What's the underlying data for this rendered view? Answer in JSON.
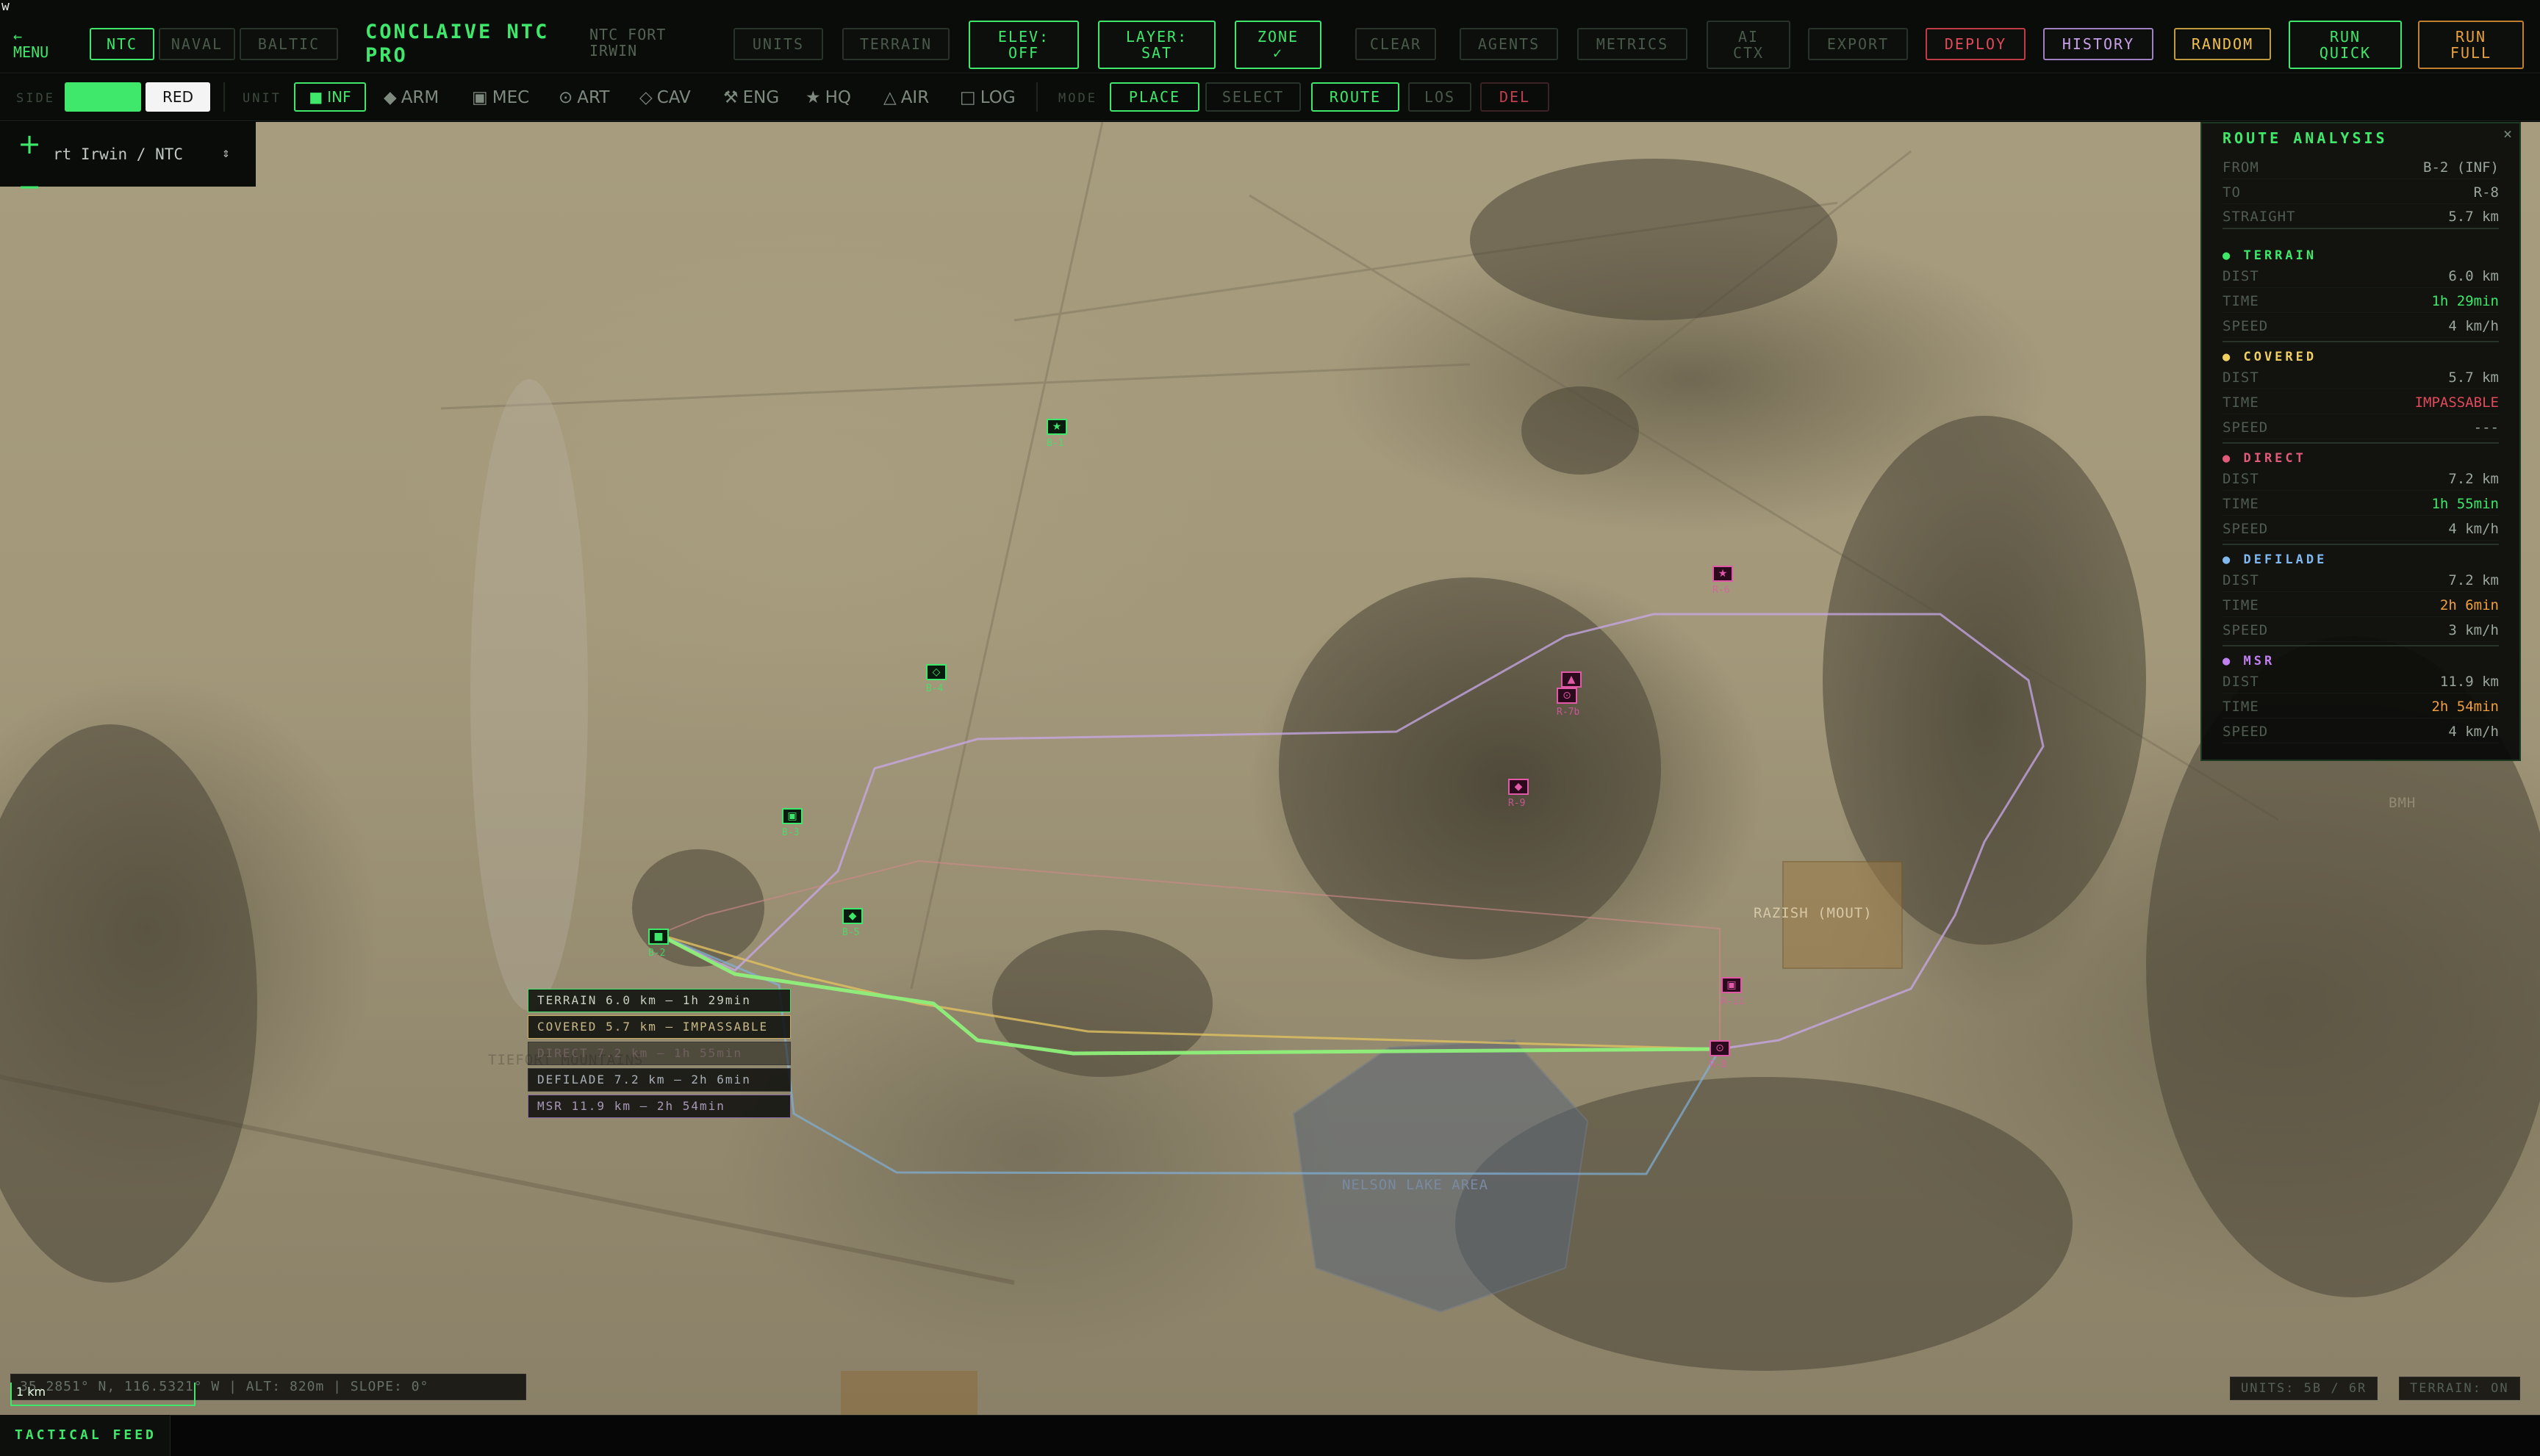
{
  "corner_glyph": "w",
  "menu": {
    "arrow": "←",
    "label": "MENU"
  },
  "theaters": [
    "NTC",
    "NAVAL",
    "BALTIC"
  ],
  "app": {
    "title_line1": "CONCLAIVE NTC",
    "title_line2": "PRO",
    "subtitle_line1": "NTC FORT",
    "subtitle_line2": "IRWIN"
  },
  "toolbar": {
    "units": "UNITS",
    "terrain": "TERRAIN",
    "elev_1": "ELEV:",
    "elev_2": "OFF",
    "layer_1": "LAYER:",
    "layer_2": "SAT",
    "zone_1": "ZONE",
    "zone_2": "✓",
    "clear": "CLEAR",
    "agents": "AGENTS",
    "metrics": "METRICS",
    "ai_1": "AI",
    "ai_2": "CTX",
    "export": "EXPORT",
    "deploy": "DEPLOY",
    "history": "HISTORY",
    "random": "RANDOM",
    "run_quick_1": "RUN",
    "run_quick_2": "QUICK",
    "run_full_1": "RUN",
    "run_full_2": "FULL"
  },
  "colors": {
    "accent": "#3fe86a",
    "red_force": "#e05aa8",
    "deploy": "#e04a5a",
    "history": "#c8a0e8",
    "random": "#f0c050",
    "run_full": "#e8a040"
  },
  "subbar": {
    "side_label": "SIDE",
    "side_blue": "BLUE",
    "side_red": "RED",
    "unit_label": "UNIT",
    "unit_types": [
      {
        "icon": "■",
        "label": "INF"
      },
      {
        "icon": "◆",
        "label": "ARM"
      },
      {
        "icon": "▣",
        "label": "MEC"
      },
      {
        "icon": "⊙",
        "label": "ART"
      },
      {
        "icon": "◇",
        "label": "CAV"
      },
      {
        "icon": "⚒",
        "label": "ENG"
      },
      {
        "icon": "★",
        "label": "HQ"
      },
      {
        "icon": "△",
        "label": "AIR"
      },
      {
        "icon": "□",
        "label": "LOG"
      }
    ],
    "mode_label": "MODE",
    "modes": [
      "PLACE",
      "SELECT",
      "ROUTE",
      "LOS",
      "DEL"
    ]
  },
  "map_controls": {
    "zoom_in": "+",
    "zoom_out": "−",
    "location": "rt Irwin / NTC",
    "location_caret": "⇕"
  },
  "units": {
    "blue": [
      {
        "id": "B-1",
        "icon": "★"
      },
      {
        "id": "B-4",
        "icon": "◇"
      },
      {
        "id": "B-3",
        "icon": "▣"
      },
      {
        "id": "B-2",
        "icon": "■"
      },
      {
        "id": "B-5",
        "icon": "◆"
      }
    ],
    "red": [
      {
        "id": "R-6",
        "icon": "★"
      },
      {
        "id": "R-7",
        "icon": "▲"
      },
      {
        "id": "R-7b",
        "icon": "⊙"
      },
      {
        "id": "R-9",
        "icon": "◆"
      },
      {
        "id": "R-11",
        "icon": "▣"
      },
      {
        "id": "R-8",
        "icon": "⊙"
      }
    ]
  },
  "map_labels": {
    "razish": "RAZISH (MOUT)",
    "tiefort": "TIEFORT MOUNTAINS",
    "nelson": "NELSON LAKE AREA",
    "bhm": "BMH"
  },
  "route_labels": [
    "TERRAIN 6.0 km — 1h 29min",
    "COVERED 5.7 km — IMPASSABLE",
    "DIRECT 7.2 km — 1h 55min",
    "DEFILADE 7.2 km — 2h 6min",
    "MSR 11.9 km — 2h 54min"
  ],
  "route_analysis": {
    "title": "ROUTE ANALYSIS",
    "close": "×",
    "from_k": "FROM",
    "from_v": "B-2 (INF)",
    "to_k": "TO",
    "to_v": "R-8",
    "straight_k": "STRAIGHT",
    "straight_v": "5.7 km",
    "sections": [
      {
        "name": "● TERRAIN",
        "color": "#3fe86a",
        "dist": "6.0 km",
        "time": "1h 29min",
        "time_color": "#3fe86a",
        "speed": "4 km/h"
      },
      {
        "name": "● COVERED",
        "color": "#f0d060",
        "dist": "5.7 km",
        "time": "IMPASSABLE",
        "time_color": "#e04a5a",
        "speed": "---"
      },
      {
        "name": "● DIRECT",
        "color": "#e05a7a",
        "dist": "7.2 km",
        "time": "1h 55min",
        "time_color": "#3fe86a",
        "speed": "4 km/h"
      },
      {
        "name": "● DEFILADE",
        "color": "#80b8f0",
        "dist": "7.2 km",
        "time": "2h 6min",
        "time_color": "#f0a040",
        "speed": "3 km/h"
      },
      {
        "name": "● MSR",
        "color": "#c080f0",
        "dist": "11.9 km",
        "time": "2h 54min",
        "time_color": "#f0a040",
        "speed": "4 km/h"
      }
    ],
    "dist_k": "DIST",
    "time_k": "TIME",
    "speed_k": "SPEED"
  },
  "status": {
    "coords": "35.2851° N, 116.5321° W | ALT: 820m | SLOPE: 0°",
    "scale": "1 km",
    "units_count": "UNITS: 5B / 6R",
    "terrain": "TERRAIN: ON"
  },
  "feed": {
    "tab": "TACTICAL FEED"
  }
}
